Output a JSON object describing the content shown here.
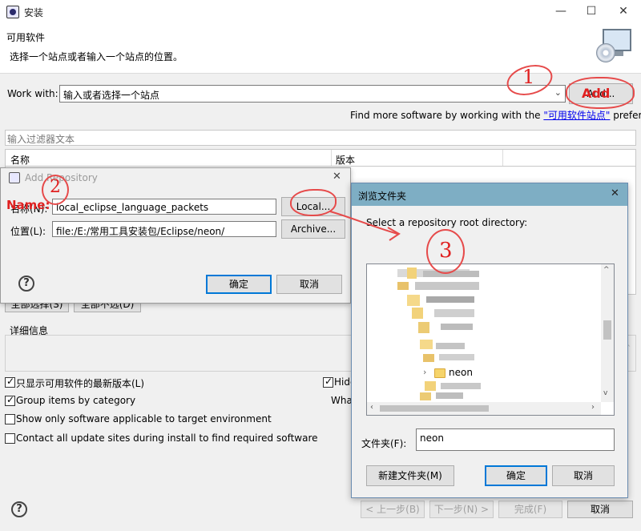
{
  "window": {
    "title": "安装",
    "minimize_glyph": "—",
    "maximize_glyph": "☐",
    "close_glyph": "✕"
  },
  "header": {
    "title": "可用软件",
    "description": "选择一个站点或者输入一个站点的位置。"
  },
  "work_with": {
    "label": "Work with:",
    "combo_text": "输入或者选择一个站点",
    "add_button": "Add...",
    "find_more_prefix": "Find more software by working with the ",
    "find_more_link": "\"可用软件站点\"",
    "find_more_suffix": " preferences."
  },
  "filter": {
    "placeholder": "输入过滤器文本"
  },
  "table": {
    "columns": [
      "名称",
      "版本"
    ]
  },
  "selection_buttons": [
    "全部选择(S)",
    "全部不选(D)"
  ],
  "details": {
    "label": "详细信息"
  },
  "options": [
    {
      "label": "只显示可用软件的最新版本(L)",
      "checked": true
    },
    {
      "label": "Group items by category",
      "checked": true
    },
    {
      "label": "Show only software applicable to target environment",
      "checked": false
    },
    {
      "label": "Contact all update sites during install to find required software",
      "checked": false
    }
  ],
  "options_right": [
    {
      "label": "Hide",
      "checked": true
    },
    {
      "label": "What",
      "checked": false
    }
  ],
  "footer_buttons": [
    {
      "label": "< 上一步(B)",
      "enabled": false
    },
    {
      "label": "下一步(N) >",
      "enabled": false
    },
    {
      "label": "完成(F)",
      "enabled": false
    },
    {
      "label": "取消",
      "enabled": true
    }
  ],
  "add_repository": {
    "title": "Add Repository",
    "name_label": "名称(N):",
    "name_value": "local_eclipse_language_packets",
    "location_label": "位置(L):",
    "location_value": "file:/E:/常用工具安装包/Eclipse/neon/",
    "local_button": "Local...",
    "archive_button": "Archive...",
    "ok_button": "确定",
    "cancel_button": "取消"
  },
  "browse_folder": {
    "title": "浏览文件夹",
    "prompt": "Select a repository root directory:",
    "selected_node": "neon",
    "folder_label": "文件夹(F):",
    "folder_value": "neon",
    "new_folder_button": "新建文件夹(M)",
    "ok_button": "确定",
    "cancel_button": "取消"
  },
  "annotations": {
    "add_text": "Add",
    "name_text": "Name:",
    "step1": "1",
    "step2": "2",
    "step3": "3"
  },
  "colors": {
    "annotation": "#e02020",
    "dialog_title_bar": "#7eaec4",
    "link": "#0000ee",
    "primary_border": "#0078d7"
  }
}
